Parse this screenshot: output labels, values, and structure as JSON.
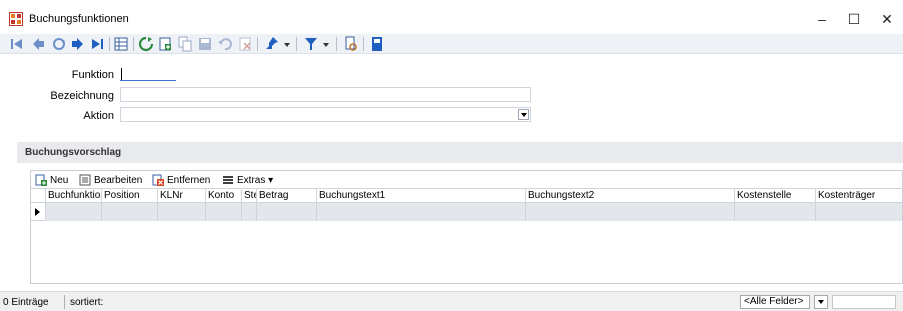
{
  "window": {
    "title": "Buchungsfunktionen",
    "minimize": "–",
    "maximize": "☐",
    "close": "✕"
  },
  "toolbar": {
    "icons": [
      "first-record-icon",
      "previous-record-icon",
      "refresh-circle-icon",
      "next-record-icon",
      "last-record-icon",
      "table-view-icon",
      "reload-icon",
      "new-record-icon",
      "copy-record-icon",
      "save-record-icon",
      "undo-icon",
      "delete-record-icon",
      "pin-icon",
      "filter-icon",
      "print-preview-icon",
      "settings-icon"
    ]
  },
  "form": {
    "funktion_label": "Funktion",
    "funktion_value": "",
    "bezeichnung_label": "Bezeichnung",
    "bezeichnung_value": "",
    "aktion_label": "Aktion",
    "aktion_value": ""
  },
  "section": {
    "title": "Buchungsvorschlag"
  },
  "grid": {
    "toolbar": {
      "new_label": "Neu",
      "edit_label": "Bearbeiten",
      "remove_label": "Entfernen",
      "extras_label": "Extras ▾"
    },
    "columns": [
      "Buchfunktion",
      "Position",
      "KLNr",
      "Konto",
      "Steuer",
      "Betrag",
      "Buchungstext1",
      "Buchungstext2",
      "Kostenstelle",
      "Kostenträger"
    ]
  },
  "status": {
    "count": "0 Einträge",
    "sort": "sortiert:",
    "filter_value": "<Alle Felder>"
  },
  "colors": {
    "toolbar_bg": "#eef1f6",
    "section_bg": "#e8eaee",
    "row_bg": "#e3e6ea",
    "status_bg": "#f0f0f0"
  }
}
